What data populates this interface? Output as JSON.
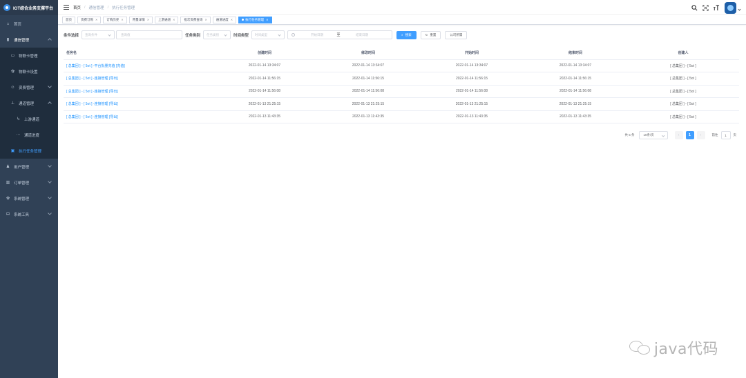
{
  "app": {
    "title": "IOT综合业务支撑平台"
  },
  "sidebar": {
    "items": [
      {
        "label": "首页",
        "icon": "home-icon"
      },
      {
        "label": "通信管理",
        "icon": "sim-icon"
      },
      {
        "label": "物联卡管理",
        "icon": "card-icon"
      },
      {
        "label": "物联卡设置",
        "icon": "gear-icon"
      },
      {
        "label": "资费管理",
        "icon": "user-icon"
      },
      {
        "label": "通道管理",
        "icon": "tree-icon"
      },
      {
        "label": "上游通道",
        "icon": "link-icon"
      },
      {
        "label": "通道进度",
        "icon": "progress-icon"
      },
      {
        "label": "执行任务管理",
        "icon": "monitor-icon"
      },
      {
        "label": "用户管理",
        "icon": "people-icon"
      },
      {
        "label": "订单管理",
        "icon": "chart-icon"
      },
      {
        "label": "系统管理",
        "icon": "gear-icon"
      },
      {
        "label": "系统工具",
        "icon": "toolbox-icon"
      }
    ]
  },
  "breadcrumb": {
    "home": "首页",
    "level1": "通信管理",
    "level2": "执行任务管理"
  },
  "tags": [
    {
      "label": "首页"
    },
    {
      "label": "资费订购"
    },
    {
      "label": "订购历史"
    },
    {
      "label": "用量详情"
    },
    {
      "label": "上游通道"
    },
    {
      "label": "批次资费查询"
    },
    {
      "label": "通道进度"
    },
    {
      "label": "执行任务管理"
    }
  ],
  "filters": {
    "condition_label": "条件选择",
    "condition_placeholder": "查询条件",
    "query_placeholder": "查询值",
    "task_type_label": "任务类别",
    "task_type_placeholder": "任务类别",
    "time_type_label": "时间类型",
    "time_type_placeholder": "时间类型",
    "start_placeholder": "开始日期",
    "range_sep": "至",
    "end_placeholder": "结束日期",
    "search_btn": "搜索",
    "reset_btn": "重置",
    "company_btn": "公司所属"
  },
  "table": {
    "headers": [
      "任务名",
      "创建时间",
      "修改时间",
      "开始时间",
      "结束时间",
      "创建人"
    ],
    "rows": [
      [
        "[ 总集团 ] - [ 5ot ] -平台批量充值 [充值]",
        "2022-01-14 13:34:07",
        "2022-01-14 13:34:07",
        "2022-01-14 13:34:07",
        "2022-01-14 13:34:07",
        "[ 总集团 ] - [ 5ot ]"
      ],
      [
        "[ 总集团 ] - [ 5ot ] -连接管理 [导出]",
        "2022-01-14 11:56:15",
        "2022-01-14 11:56:15",
        "2022-01-14 11:56:15",
        "2022-01-14 11:56:15",
        "[ 总集团 ] - [ 5ot ]"
      ],
      [
        "[ 总集团 ] - [ 5ot ] -连接管理 [导出]",
        "2022-01-14 11:56:08",
        "2022-01-14 11:56:08",
        "2022-01-14 11:56:08",
        "2022-01-14 11:56:08",
        "[ 总集团 ] - [ 5ot ]"
      ],
      [
        "[ 总集团 ] - [ 5ot ] -连接管理 [导出]",
        "2022-01-13 21:25:15",
        "2022-01-13 21:25:15",
        "2022-01-13 21:25:15",
        "2022-01-13 21:25:15",
        "[ 总集团 ] - [ 5ot ]"
      ],
      [
        "[ 总集团 ] - [ 5ot ] -连接管理 [导出]",
        "2022-01-13 11:43:35",
        "2022-01-13 11:43:35",
        "2022-01-13 11:43:35",
        "2022-01-13 11:43:35",
        "[ 总集团 ] - [ 5ot ]"
      ]
    ]
  },
  "pagination": {
    "total_text": "共 5 条",
    "page_size": "10条/页",
    "prev": "‹",
    "current": "1",
    "next": "›",
    "goto_label": "前往",
    "goto_value": "1",
    "page_unit": "页"
  },
  "watermark": {
    "text": "java代码"
  },
  "colors": {
    "sidebar_bg": "#304156",
    "accent": "#409eff",
    "link": "#1890ff"
  }
}
